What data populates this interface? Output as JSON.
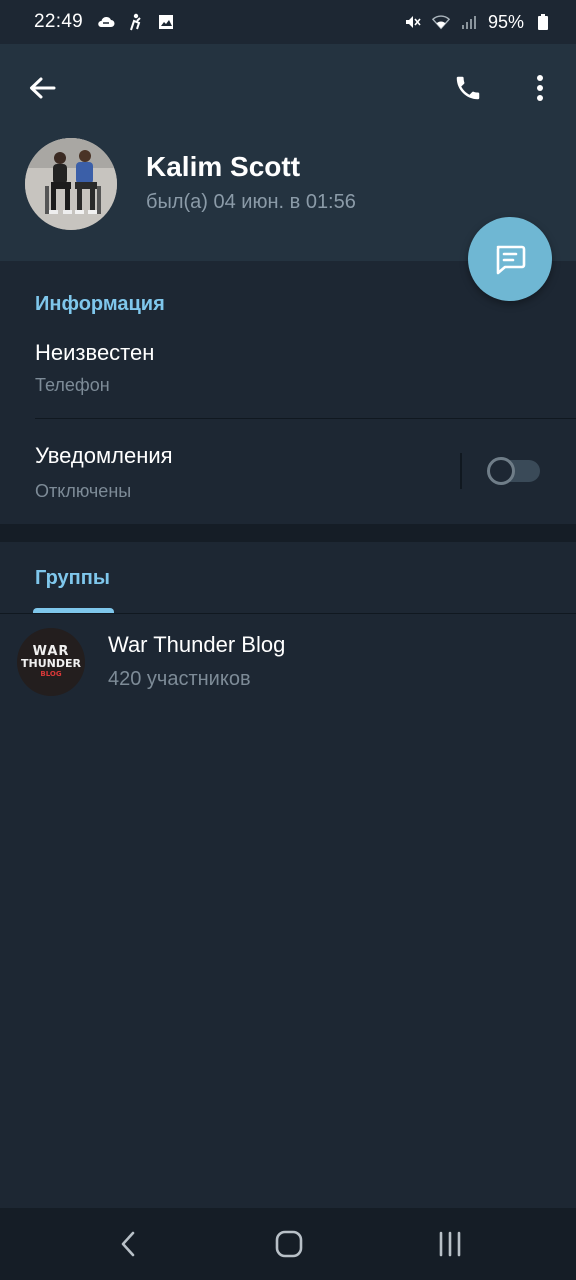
{
  "status_bar": {
    "time": "22:49",
    "left_icons": [
      "cloud-icon",
      "accessibility-icon",
      "image-icon"
    ],
    "right_icons": [
      "mute-icon",
      "wifi-icon",
      "signal-icon"
    ],
    "battery_percent": "95%"
  },
  "header": {
    "name": "Kalim Scott",
    "last_seen": "был(а) 04 июн. в 01:56"
  },
  "info": {
    "section_title": "Информация",
    "phone_value": "Неизвестен",
    "phone_label": "Телефон",
    "notifications_label": "Уведомления",
    "notifications_value": "Отключены",
    "notifications_enabled": false
  },
  "groups": {
    "tab_label": "Группы",
    "items": [
      {
        "name": "War Thunder Blog",
        "members": "420 участников",
        "avatar_lines": [
          "WAR",
          "THUNDER",
          "BLOG"
        ]
      }
    ]
  },
  "colors": {
    "background": "#1d2733",
    "header": "#243340",
    "accent": "#7fc7ec",
    "fab": "#6fb7d3",
    "secondary_text": "#7d8b97"
  }
}
